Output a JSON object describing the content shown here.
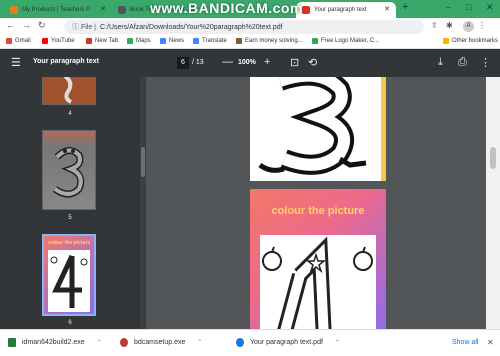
{
  "browser": {
    "tabs": [
      {
        "label": "My Products | Teachers P",
        "active": false
      },
      {
        "label": "Book Title Generator - D",
        "active": false
      },
      {
        "label": "Your paragraph text",
        "active": true
      }
    ],
    "new_tab": "+",
    "watermark": "www.BANDICAM.com",
    "window_controls": {
      "minimize": "–",
      "maximize": "□",
      "close": "✕"
    },
    "address": {
      "scheme_label": "File",
      "url": "C:/Users/Afzan/Downloads/Your%20paragraph%20text.pdf"
    },
    "avatar_initial": "A",
    "bookmarks": [
      {
        "label": "Gmail",
        "color": "#ea4335"
      },
      {
        "label": "YouTube",
        "color": "#ff0000"
      },
      {
        "label": "New Tab",
        "color": "#d93025"
      },
      {
        "label": "Maps",
        "color": "#34a853"
      },
      {
        "label": "News",
        "color": "#4285f4"
      },
      {
        "label": "Translate",
        "color": "#4285f4"
      },
      {
        "label": "Earn money solving...",
        "color": "#7a5c2e"
      },
      {
        "label": "Free Logo Maker, C...",
        "color": "#34a853"
      }
    ],
    "other_bookmarks": "Other bookmarks"
  },
  "pdf": {
    "title": "Your paragraph text",
    "current_page": "6",
    "total_pages": "/ 13",
    "zoom": "100%",
    "zoom_out": "—",
    "zoom_in": "+",
    "thumbnails": [
      {
        "label": "4"
      },
      {
        "label": "5"
      },
      {
        "label": "6",
        "heading": "colour the picture"
      }
    ],
    "page_heading": "colour the picture"
  },
  "downloads": [
    {
      "name": "idman642build2.exe",
      "color": "#2b7a3d"
    },
    {
      "name": "bdcamsetup.exe",
      "color": "#c0392b"
    },
    {
      "name": "Your paragraph text.pdf",
      "color": "#1a73e8"
    }
  ],
  "show_all": "Show all",
  "colors": {
    "accent": "#3aa86a",
    "pdf_toolbar": "#323639"
  }
}
